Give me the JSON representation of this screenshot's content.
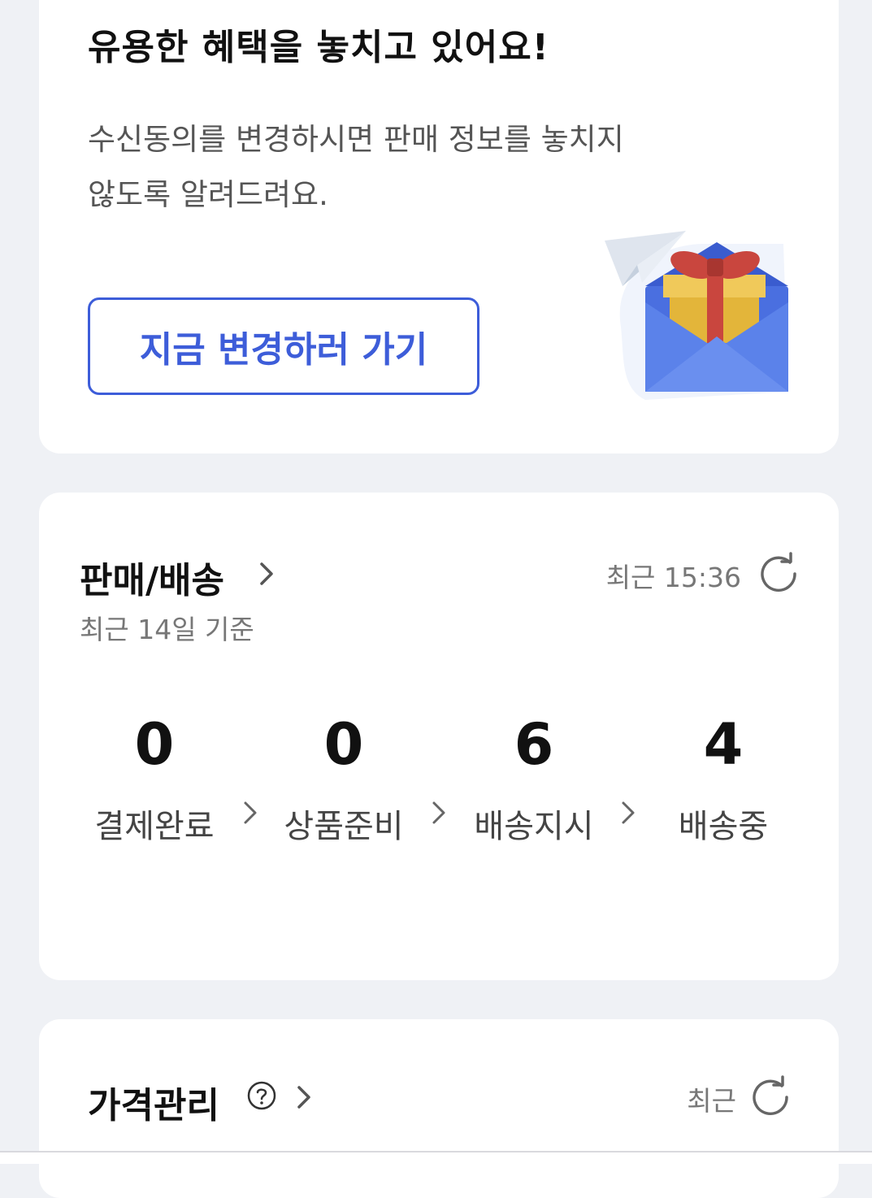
{
  "promo": {
    "title": "유용한 혜택을 놓치고 있어요!",
    "desc_line1": "수신동의를 변경하시면 판매 정보를 놓치지",
    "desc_line2": "않도록 알려드려요.",
    "button_label": "지금 변경하러 가기",
    "illustration": "gift-envelope-illustration"
  },
  "sales": {
    "title": "판매/배송",
    "subtitle": "최근 14일 기준",
    "updated": "최근 15:36",
    "stats": [
      {
        "value": "0",
        "label": "결제완료"
      },
      {
        "value": "0",
        "label": "상품준비"
      },
      {
        "value": "6",
        "label": "배송지시"
      },
      {
        "value": "4",
        "label": "배송중"
      }
    ]
  },
  "price": {
    "title": "가격관리",
    "updated": "최근"
  },
  "colors": {
    "accent": "#3d5dd9",
    "background": "#eff1f5",
    "card": "#ffffff"
  },
  "icons": [
    "chevron-right-icon",
    "refresh-icon",
    "help-icon"
  ]
}
